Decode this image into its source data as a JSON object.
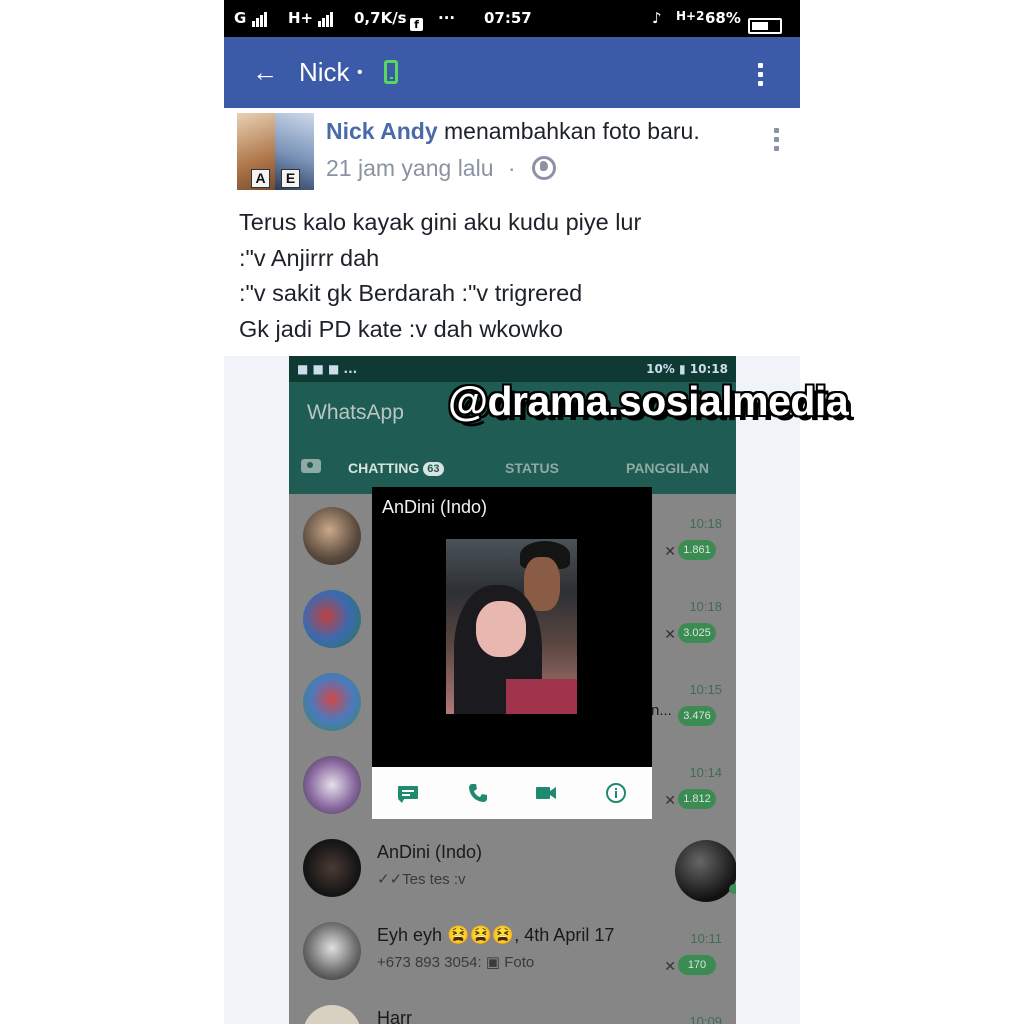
{
  "status_bar": {
    "carrier1": "G",
    "carrier2": "H+",
    "speed": "0,7K/s",
    "dots": "···",
    "time": "07:57",
    "net": "H+2",
    "battery": "68%",
    "mute_glyph": "♪"
  },
  "app_bar": {
    "back_glyph": "←",
    "title": "Nick",
    "separator": "•"
  },
  "post": {
    "author": "Nick Andy",
    "action": " menambahkan foto baru.",
    "time": "21 jam yang lalu",
    "time_separator": "·",
    "avatar_tags": [
      "A",
      "E"
    ],
    "lines": [
      "Terus kalo kayak gini aku kudu piye lur",
      ":\"v Anjirrr dah",
      ":\"v sakit gk Berdarah :\"v trigrered",
      "Gk jadi PD kate :v dah wkowko"
    ]
  },
  "whatsapp": {
    "status_left": "■ ■ ■ ...",
    "status_right": "10% ▮ 10:18",
    "brand": "WhatsApp",
    "tabs": [
      {
        "label": "CHATTING",
        "count": "63"
      },
      {
        "label": "STATUS"
      },
      {
        "label": "PANGGILAN"
      }
    ],
    "chats": [
      {
        "time": "10:18",
        "unread": "1.861",
        "mute": "✕"
      },
      {
        "time": "10:18",
        "unread": "3.025",
        "mute": "✕"
      },
      {
        "time": "10:15",
        "unread": "3.476",
        "trail": "n..."
      },
      {
        "time": "10:14",
        "unread": "1.812",
        "mute": "✕"
      },
      {
        "name": "AnDini (Indo)",
        "preview": "✓✓Tes tes :v"
      },
      {
        "name": "Eyh eyh 😫😫😫, 4th April 17",
        "preview": "+673 893 3054: ▣ Foto",
        "time": "10:11",
        "unread": "170",
        "mute": "✕"
      },
      {
        "name": "Harr",
        "time": "10:09"
      }
    ],
    "popup": {
      "title": "AnDini (Indo)",
      "actions": [
        "message-icon",
        "phone-icon",
        "video-icon",
        "info-icon"
      ]
    }
  },
  "watermark": "@drama.sosialmedia",
  "colors": {
    "facebook_blue": "#3b5ba8",
    "whatsapp_green": "#1f5c53",
    "online_green": "#58d85c"
  }
}
